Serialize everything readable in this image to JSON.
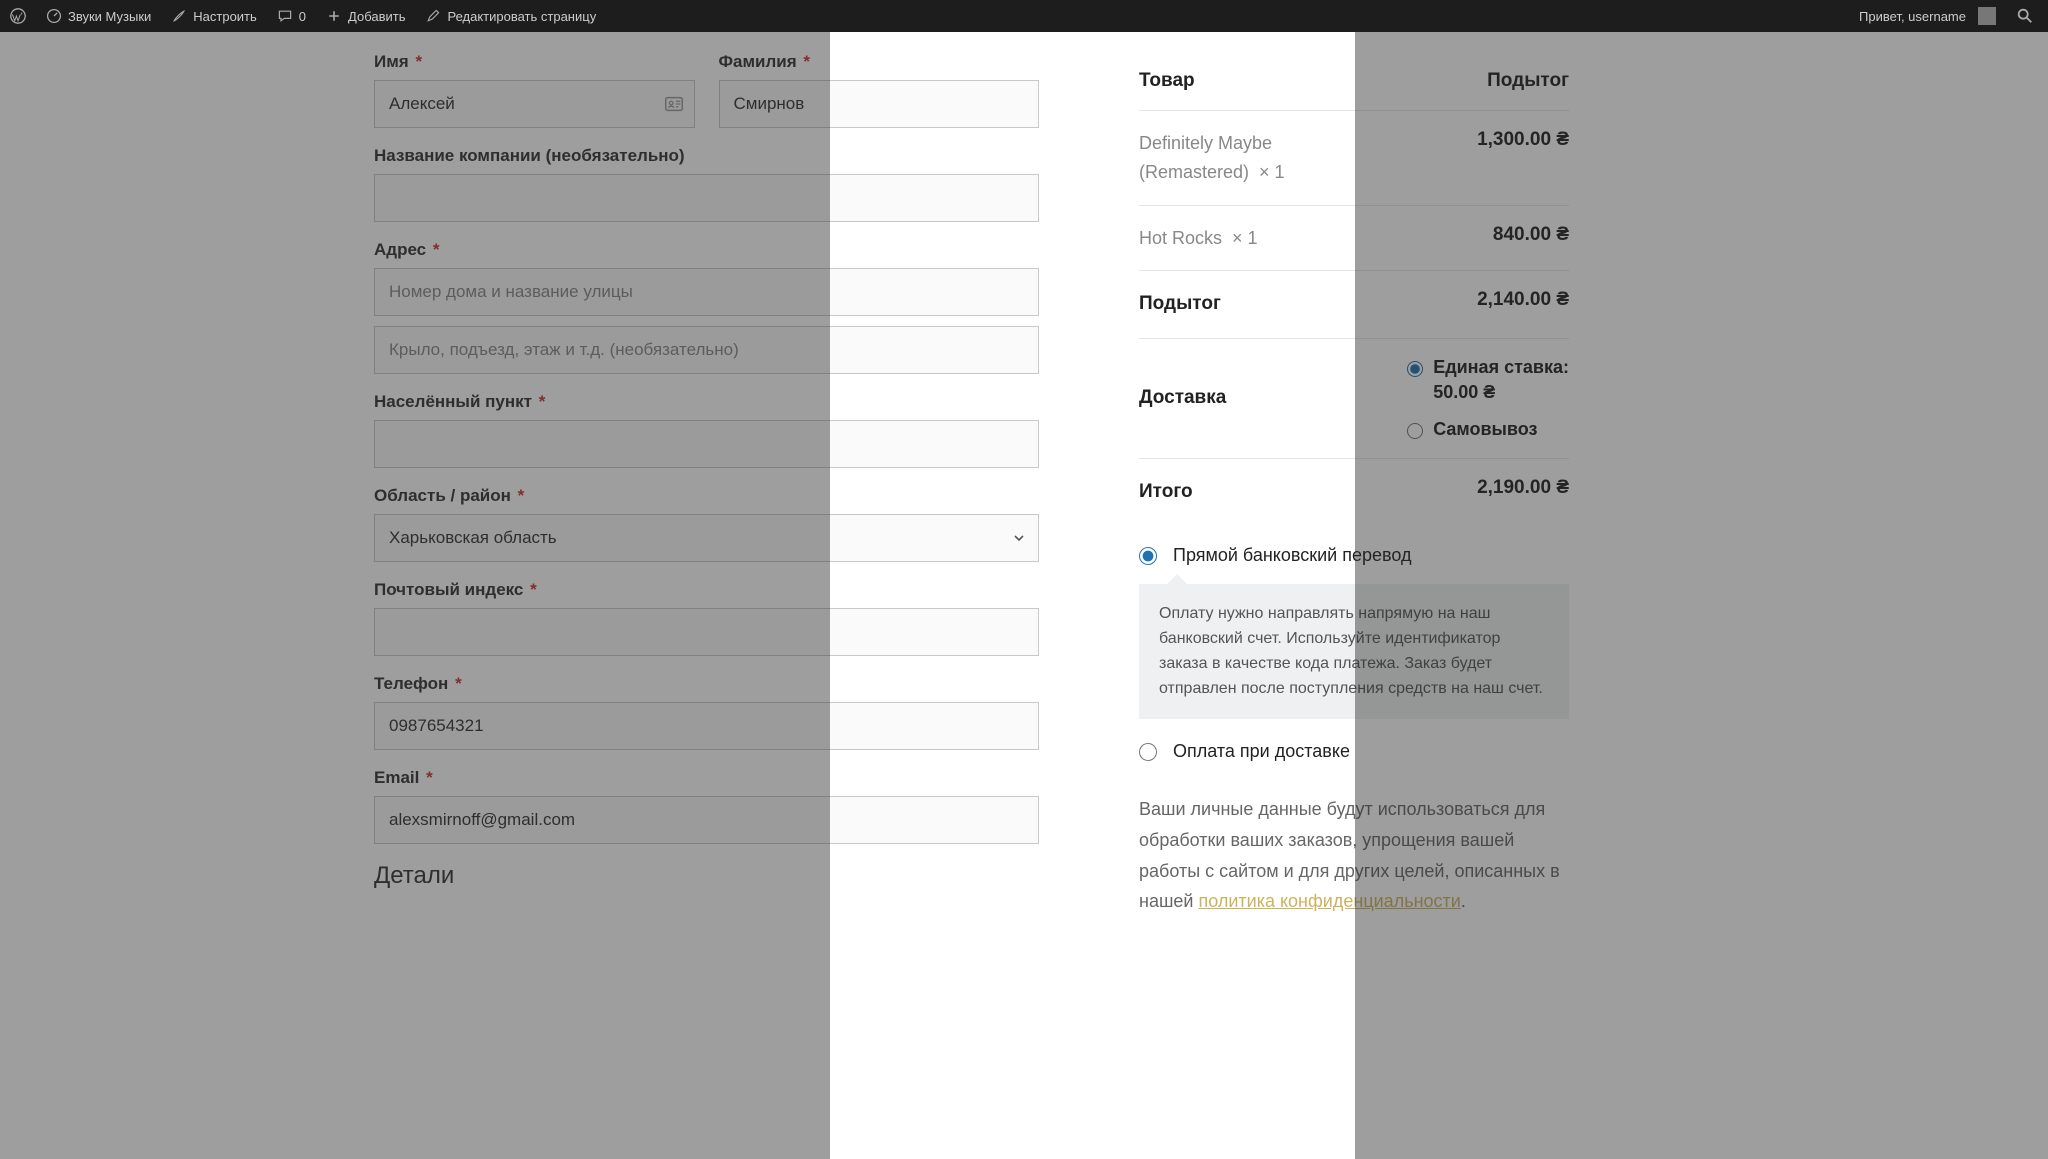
{
  "adminbar": {
    "site_name": "Звуки Музыки",
    "customize": "Настроить",
    "comments_count": "0",
    "add_new": "Добавить",
    "edit_page": "Редактировать страницу",
    "greeting": "Привет, username"
  },
  "billing": {
    "first_name": {
      "label": "Имя",
      "value": "Алексей"
    },
    "last_name": {
      "label": "Фамилия",
      "value": "Смирнов"
    },
    "company": {
      "label": "Название компании (необязательно)",
      "value": ""
    },
    "address": {
      "label": "Адрес",
      "line1_placeholder": "Номер дома и название улицы",
      "line1_value": "",
      "line2_placeholder": "Крыло, подъезд, этаж и т.д. (необязательно)",
      "line2_value": ""
    },
    "city": {
      "label": "Населённый пункт",
      "value": ""
    },
    "state": {
      "label": "Область / район",
      "value": "Харьковская область"
    },
    "postcode": {
      "label": "Почтовый индекс",
      "value": ""
    },
    "phone": {
      "label": "Телефон",
      "value": "0987654321"
    },
    "email": {
      "label": "Email",
      "value": "alexsmirnoff@gmail.com"
    },
    "details_heading": "Детали"
  },
  "summary": {
    "header": {
      "product": "Товар",
      "subtotal": "Подытог"
    },
    "items": [
      {
        "name": "Definitely Maybe (Remastered)",
        "qty": "× 1",
        "price": "1,300.00 ₴"
      },
      {
        "name": "Hot Rocks",
        "qty": "× 1",
        "price": "840.00 ₴"
      }
    ],
    "subtotal": {
      "label": "Подытог",
      "value": "2,140.00 ₴"
    },
    "shipping": {
      "label": "Доставка",
      "options": [
        {
          "label": "Единая ставка:",
          "price": "50.00 ₴",
          "selected": true
        },
        {
          "label": "Самовывоз",
          "price": "",
          "selected": false
        }
      ]
    },
    "total": {
      "label": "Итого",
      "value": "2,190.00 ₴"
    }
  },
  "payment": {
    "methods": [
      {
        "label": "Прямой банковский перевод",
        "selected": true,
        "desc": "Оплату нужно направлять напрямую на наш банковский счет. Используйте идентификатор заказа в качестве кода платежа. Заказ будет отправлен после поступления средств на наш счет."
      },
      {
        "label": "Оплата при доставке",
        "selected": false
      }
    ],
    "privacy_text": "Ваши личные данные будут использоваться для обработки ваших заказов, упрощения вашей работы с сайтом и для других целей, описанных в нашей ",
    "privacy_link": "политика конфиденциальности",
    "privacy_suffix": "."
  }
}
